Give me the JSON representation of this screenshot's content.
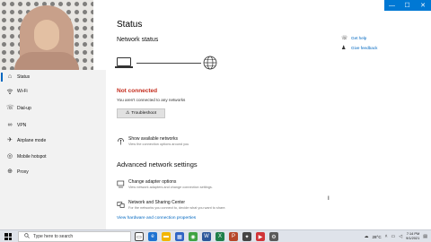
{
  "window": {
    "minimize_glyph": "—",
    "maximize_glyph": "☐",
    "close_glyph": "✕",
    "accent": "#0078d4"
  },
  "sidebar": {
    "items": [
      {
        "label": "Status",
        "icon": "home-icon",
        "active": true
      },
      {
        "label": "Wi-Fi",
        "icon": "wifi-icon"
      },
      {
        "label": "Dial-up",
        "icon": "dialup-icon"
      },
      {
        "label": "VPN",
        "icon": "vpn-icon"
      },
      {
        "label": "Airplane mode",
        "icon": "airplane-icon"
      },
      {
        "label": "Mobile hotspot",
        "icon": "hotspot-icon"
      },
      {
        "label": "Proxy",
        "icon": "globe-icon"
      }
    ]
  },
  "main": {
    "title": "Status",
    "network_status_label": "Network status",
    "not_connected": "Not connected",
    "not_connected_sub": "You aren't connected to any networks",
    "troubleshoot_label": "Troubleshoot",
    "show_networks": {
      "title": "Show available networks",
      "sub": "View the connection options around you"
    },
    "advanced_title": "Advanced network settings",
    "change_adapter": {
      "title": "Change adapter options",
      "sub": "View network adapters and change connection settings."
    },
    "sharing_center": {
      "title": "Network and Sharing Center",
      "sub": "For the networks you connect to, decide what you want to share."
    },
    "view_properties": "View hardware and connection properties",
    "help": {
      "get_help": "Get help",
      "give_feedback": "Give feedback"
    },
    "error_color": "#c42b1c",
    "link_color": "#0067c0"
  },
  "taskbar": {
    "search_placeholder": "Type here to search",
    "weather": "28°C",
    "time": "7:14 PM",
    "date": "9/1/2021"
  }
}
